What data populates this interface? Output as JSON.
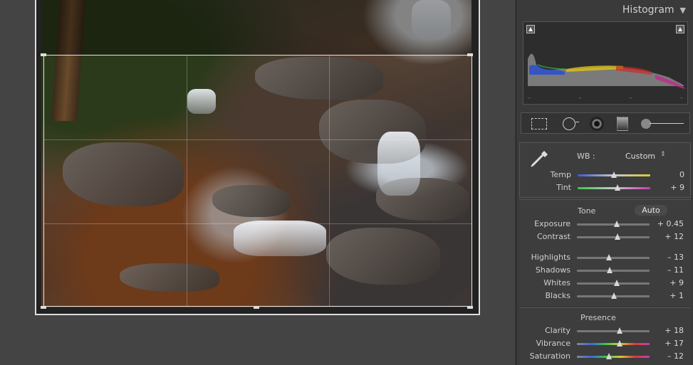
{
  "panel": {
    "title": "Histogram",
    "toggle_icon": "triangle-down-icon"
  },
  "histogram": {
    "ticks": [
      "–",
      "–",
      "–",
      "–"
    ]
  },
  "tools": [
    "crop-overlay-icon",
    "spot-removal-icon",
    "red-eye-icon",
    "graduated-filter-icon",
    "adjustment-brush-icon"
  ],
  "wb": {
    "label": "WB :",
    "value": "Custom",
    "arrows": "⇕"
  },
  "wb_sliders": [
    {
      "label": "Temp",
      "value": "0",
      "pos": 0.5,
      "kind": "temp"
    },
    {
      "label": "Tint",
      "value": "+ 9",
      "pos": 0.55,
      "kind": "tint"
    }
  ],
  "tone": {
    "title": "Tone",
    "auto": "Auto",
    "sliders": [
      {
        "label": "Exposure",
        "value": "+ 0.45",
        "pos": 0.545
      },
      {
        "label": "Contrast",
        "value": "+ 12",
        "pos": 0.56
      }
    ],
    "sliders2": [
      {
        "label": "Highlights",
        "value": "– 13",
        "pos": 0.44
      },
      {
        "label": "Shadows",
        "value": "– 11",
        "pos": 0.45
      },
      {
        "label": "Whites",
        "value": "+ 9",
        "pos": 0.55
      },
      {
        "label": "Blacks",
        "value": "+ 1",
        "pos": 0.505
      }
    ]
  },
  "presence": {
    "title": "Presence",
    "sliders": [
      {
        "label": "Clarity",
        "value": "+ 18",
        "pos": 0.59,
        "kind": "plain"
      },
      {
        "label": "Vibrance",
        "value": "+ 17",
        "pos": 0.585,
        "kind": "vib"
      },
      {
        "label": "Saturation",
        "value": "– 12",
        "pos": 0.44,
        "kind": "sat"
      }
    ]
  }
}
